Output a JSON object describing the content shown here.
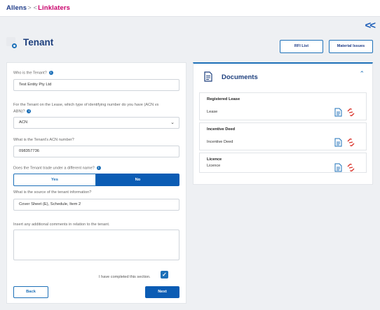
{
  "header": {
    "brand_left": "Allens",
    "brand_mid": "> <",
    "brand_right": "Linklaters"
  },
  "page": {
    "title": "Tenant",
    "collapse_glyph": "<<"
  },
  "actions": {
    "rfi_list": "RFI List",
    "material_issues": "Material Issues"
  },
  "form": {
    "who_label": "Who is the Tenant?",
    "who_value": "Test Entity Pty Ltd",
    "identifier_label_1": "For the Tenant on the Lease, which type of identifying number do you have (ACN vs",
    "identifier_label_2": "ABN)?",
    "identifier_value": "ACN",
    "acn_label": "What is the Tenant's ACN number?",
    "acn_value": "098357736",
    "trade_label": "Does the Tenant trade under a different name?",
    "yes_label": "Yes",
    "no_label": "No",
    "selected_option": "No",
    "source_label": "What is the source of the tenant information?",
    "source_value": "Cover Sheet (E), Schedule, Item 2",
    "comments_label": "Insert any additional comments in relation to the tenant.",
    "comments_value": "",
    "completed_label": "I have completed this section.",
    "completed": true,
    "back_label": "Back",
    "next_label": "Next"
  },
  "documents": {
    "title": "Documents",
    "items": [
      {
        "name": "Registered Lease",
        "subtitle": "Lease"
      },
      {
        "name": "Incentive Deed",
        "subtitle": "Incentive Deed"
      },
      {
        "name": "Licence",
        "subtitle": "Licence"
      }
    ]
  },
  "colors": {
    "primary": "#0b5cb4",
    "brand_navy": "#1f3c88",
    "brand_magenta": "#c9006b",
    "link_red": "#d9342b"
  },
  "icons": [
    "collapse-icon",
    "tenant-icon",
    "info-icon",
    "chevron-down-icon",
    "checkbox-checked-icon",
    "document-icon",
    "unlink-icon",
    "caret-up-icon"
  ]
}
